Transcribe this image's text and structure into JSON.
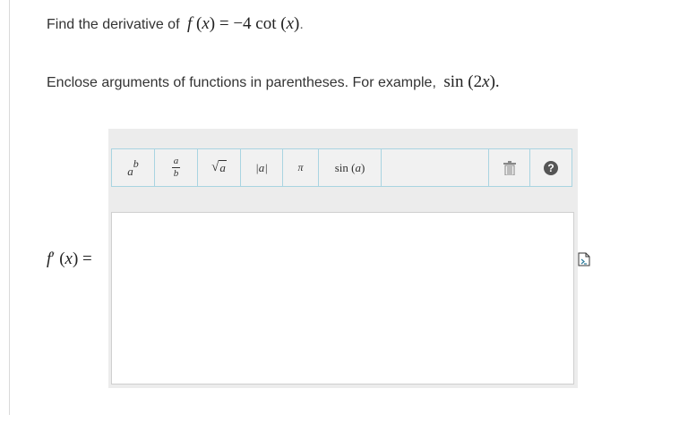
{
  "question": {
    "prefix": "Find the derivative of",
    "func_name": "f",
    "var": "x",
    "rhs": "= −4 cot (",
    "rhs_end": ")",
    "end": "."
  },
  "instruction": {
    "text": "Enclose arguments of functions in parentheses. For example,",
    "example_func": "sin",
    "example_arg": "(2",
    "example_var": "x",
    "example_close": ")",
    "end": "."
  },
  "toolbar": {
    "superscript": {
      "base": "a",
      "exp": "b"
    },
    "fraction": {
      "num": "a",
      "den": "b"
    },
    "sqrt": {
      "sym": "√",
      "arg": "a"
    },
    "abs": {
      "label": "|a|"
    },
    "pi": {
      "label": "π"
    },
    "sin": {
      "func": "sin",
      "arg": "a"
    },
    "help": {
      "label": "?"
    }
  },
  "answer": {
    "label_func": "f",
    "label_prime": "′",
    "label_open": " (",
    "label_var": "x",
    "label_close": ") =",
    "value": ""
  }
}
